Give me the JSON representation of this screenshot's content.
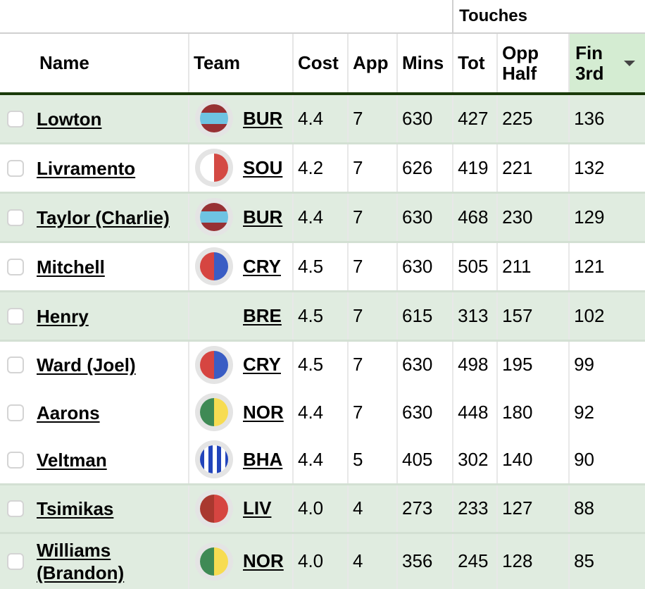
{
  "table": {
    "group_header": "Touches",
    "columns": {
      "name": "Name",
      "team": "Team",
      "cost": "Cost",
      "app": "App",
      "mins": "Mins",
      "tot": "Tot",
      "opp_half": "Opp Half",
      "fin_3rd": "Fin 3rd"
    },
    "sorted_column": "fin_3rd",
    "sort_direction": "descending",
    "rows": [
      {
        "name": "Lowton",
        "team": "BUR",
        "badge": "burnley-badge-icon",
        "cost": "4.4",
        "app": "7",
        "mins": "630",
        "tot": "427",
        "opp_half": "225",
        "fin_3rd": "136"
      },
      {
        "name": "Livramento",
        "team": "SOU",
        "badge": "southampton-badge-icon",
        "cost": "4.2",
        "app": "7",
        "mins": "626",
        "tot": "419",
        "opp_half": "221",
        "fin_3rd": "132"
      },
      {
        "name": "Taylor (Charlie)",
        "team": "BUR",
        "badge": "burnley-badge-icon",
        "cost": "4.4",
        "app": "7",
        "mins": "630",
        "tot": "468",
        "opp_half": "230",
        "fin_3rd": "129"
      },
      {
        "name": "Mitchell",
        "team": "CRY",
        "badge": "crystal-palace-badge-icon",
        "cost": "4.5",
        "app": "7",
        "mins": "630",
        "tot": "505",
        "opp_half": "211",
        "fin_3rd": "121"
      },
      {
        "name": "Henry",
        "team": "BRE",
        "badge": "",
        "cost": "4.5",
        "app": "7",
        "mins": "615",
        "tot": "313",
        "opp_half": "157",
        "fin_3rd": "102"
      },
      {
        "name": "Ward (Joel)",
        "team": "CRY",
        "badge": "crystal-palace-badge-icon",
        "cost": "4.5",
        "app": "7",
        "mins": "630",
        "tot": "498",
        "opp_half": "195",
        "fin_3rd": "99"
      },
      {
        "name": "Aarons",
        "team": "NOR",
        "badge": "norwich-badge-icon",
        "cost": "4.4",
        "app": "7",
        "mins": "630",
        "tot": "448",
        "opp_half": "180",
        "fin_3rd": "92"
      },
      {
        "name": "Veltman",
        "team": "BHA",
        "badge": "brighton-badge-icon",
        "cost": "4.4",
        "app": "5",
        "mins": "405",
        "tot": "302",
        "opp_half": "140",
        "fin_3rd": "90"
      },
      {
        "name": "Tsimikas",
        "team": "LIV",
        "badge": "liverpool-badge-icon",
        "cost": "4.0",
        "app": "4",
        "mins": "273",
        "tot": "233",
        "opp_half": "127",
        "fin_3rd": "88"
      },
      {
        "name": "Williams (Brandon)",
        "team": "NOR",
        "badge": "norwich-badge-icon",
        "cost": "4.0",
        "app": "4",
        "mins": "356",
        "tot": "245",
        "opp_half": "128",
        "fin_3rd": "85"
      }
    ]
  },
  "colors": {
    "row_highlight": "#e0ece0",
    "sorted_header": "#d4ecd2",
    "header_rule": "#1a3a0a",
    "badges": {
      "BUR": [
        "#973034",
        "#6ec3e2"
      ],
      "SOU": [
        "#ffffff",
        "#d44a44"
      ],
      "CRY": [
        "#d64541",
        "#3a5dc4"
      ],
      "NOR": [
        "#3f8a55",
        "#f7dc52"
      ],
      "BHA": [
        "#2244bb",
        "#ffffff"
      ],
      "LIV": [
        "#a9382f",
        "#d64541"
      ]
    }
  }
}
